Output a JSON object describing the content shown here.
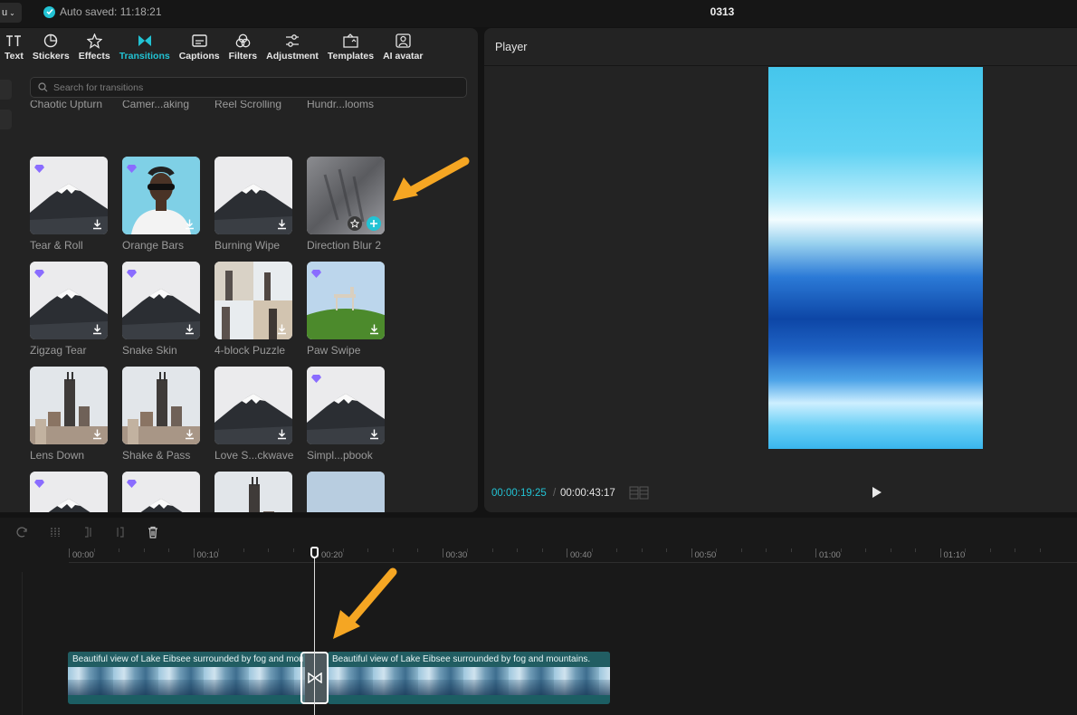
{
  "topbar": {
    "menu_label": "u",
    "autosave_text": "Auto saved: 11:18:21",
    "project_title": "0313"
  },
  "tabs": [
    {
      "label": "Text",
      "icon": "text-icon"
    },
    {
      "label": "Stickers",
      "icon": "sticker-icon"
    },
    {
      "label": "Effects",
      "icon": "effects-star-icon"
    },
    {
      "label": "Transitions",
      "icon": "transition-bowtie-icon",
      "active": true
    },
    {
      "label": "Captions",
      "icon": "captions-icon"
    },
    {
      "label": "Filters",
      "icon": "filters-icon"
    },
    {
      "label": "Adjustment",
      "icon": "adjustment-sliders-icon"
    },
    {
      "label": "Templates",
      "icon": "templates-icon"
    },
    {
      "label": "AI avatar",
      "icon": "ai-avatar-icon"
    }
  ],
  "search": {
    "placeholder": "Search for transitions"
  },
  "transitions": [
    {
      "label": "Chaotic Upturn",
      "thumb": "grass"
    },
    {
      "label": "Camer...aking",
      "thumb": "city-blur"
    },
    {
      "label": "Reel Scrolling",
      "thumb": "building"
    },
    {
      "label": "Hundr...looms",
      "thumb": "lake-house"
    },
    {
      "label": "Tear & Roll",
      "thumb": "mountain",
      "premium": true
    },
    {
      "label": "Orange Bars",
      "thumb": "person",
      "premium": true
    },
    {
      "label": "Burning Wipe",
      "thumb": "mountain"
    },
    {
      "label": "Direction Blur 2",
      "thumb": "blur",
      "hovered": true
    },
    {
      "label": "Zigzag Tear",
      "thumb": "mountain",
      "premium": true
    },
    {
      "label": "Snake Skin",
      "thumb": "mountain",
      "premium": true
    },
    {
      "label": "4-block Puzzle",
      "thumb": "puzzle"
    },
    {
      "label": "Paw Swipe",
      "thumb": "grass-chair",
      "premium": true
    },
    {
      "label": "Lens Down",
      "thumb": "tower"
    },
    {
      "label": "Shake & Pass",
      "thumb": "tower"
    },
    {
      "label": "Love S...ckwave",
      "thumb": "mountain"
    },
    {
      "label": "Simpl...pbook",
      "thumb": "mountain",
      "premium": true
    },
    {
      "label": "",
      "thumb": "mountain",
      "premium": true
    },
    {
      "label": "",
      "thumb": "mountain",
      "premium": true
    },
    {
      "label": "",
      "thumb": "tower"
    },
    {
      "label": "",
      "thumb": "sky"
    }
  ],
  "player": {
    "title": "Player",
    "current_time": "00:00:19:25",
    "separator": "/",
    "total_time": "00:00:43:17"
  },
  "timeline": {
    "ruler": [
      "00:00",
      "00:10",
      "00:20",
      "00:30",
      "00:40",
      "00:50",
      "01:00",
      "01:10"
    ],
    "clips": [
      {
        "title": "Beautiful view of Lake Eibsee surrounded by fog and mou"
      },
      {
        "title": "Beautiful view of Lake Eibsee surrounded by fog and mountains."
      }
    ],
    "track_menu": "..."
  },
  "colors": {
    "accent": "#22c3d4",
    "annotation_arrow": "#f5a623",
    "premium": "#8a6cff"
  }
}
